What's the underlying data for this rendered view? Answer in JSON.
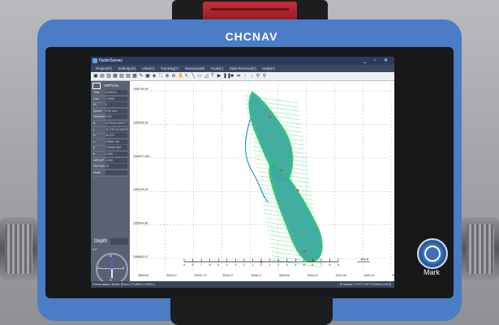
{
  "device": {
    "brand": "CHCNAV",
    "mark_label": "Mark"
  },
  "app": {
    "title": "HydroSurvey",
    "window_controls": "_ ▫ ✕",
    "menu": [
      "Project(P)",
      "Settings(S)",
      "View(V)",
      "Tracking(T)",
      "Measure(M)",
      "Tools(L)",
      "Data Process(D)",
      "Help(H)"
    ]
  },
  "panel": {
    "header": "VIRTUAL",
    "rows": [
      {
        "key": "Time",
        "value": "13:56:21"
      },
      {
        "key": "Line",
        "value": "1.0000"
      },
      {
        "key": "ID",
        "value": "0"
      },
      {
        "key": "Speed",
        "value": "0.00 m/s"
      },
      {
        "key": "Direction",
        "value": "0.00°"
      },
      {
        "key": "B",
        "value": "22°39'11.44377\""
      },
      {
        "key": "L",
        "value": "113°35'18.34623\""
      },
      {
        "key": "H",
        "value": "26.470"
      },
      {
        "key": "x",
        "value": "19998.148"
      },
      {
        "key": "y",
        "value": "703453.984"
      },
      {
        "key": "h",
        "value": "0.000"
      },
      {
        "key": "HRDOP",
        "value": "0.000"
      },
      {
        "key": "Sat Num",
        "value": "16"
      },
      {
        "key": "Mode",
        "value": ""
      }
    ],
    "depth_label": "Depth",
    "compass": {
      "value": "0.0°",
      "n": "N",
      "s": "S",
      "e": "E",
      "w": "W"
    }
  },
  "map": {
    "y_ticks": [
      "2559794.69",
      "2559596.40",
      "2559377.806",
      "2559159.93",
      "2558940.80",
      "2558692.47"
    ],
    "x_ticks": [
      "38948.60",
      "39060.07",
      "39096.779",
      "39162.27",
      "39238.27",
      "39300.80",
      "39363.23",
      "39427.68",
      "39491.60",
      "39553.071"
    ],
    "scale_numbers": [
      "9",
      "8",
      "7",
      "6",
      "5",
      "4",
      "3",
      "2",
      "1",
      "0",
      "1",
      "2",
      "3",
      "4",
      "5",
      "6",
      "7",
      "8",
      "9"
    ],
    "scale_label": "192.6"
  },
  "status": {
    "left": "Presentation Mode [Prev:CT1000:1C3000 ]",
    "right": "[Position:CTRTT-5FT:720004-2310]"
  },
  "colors": {
    "frame": "#4b7cc6",
    "map_fill": "#3aa7a0",
    "map_lines": "#2ec56a",
    "track": "#2f8fd4",
    "accent": "#c6303a"
  }
}
